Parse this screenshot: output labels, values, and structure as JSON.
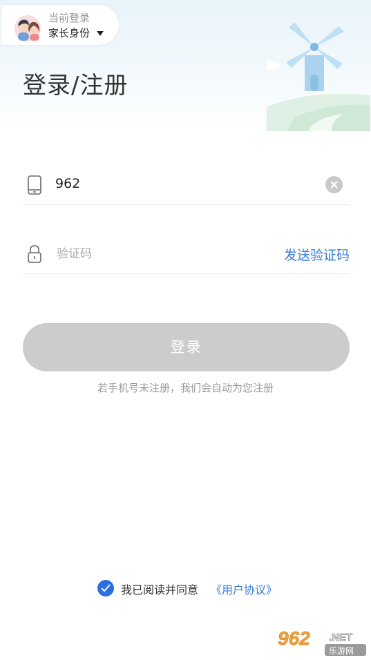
{
  "header": {
    "identity_caption": "当前登录",
    "identity_value": "家长身份",
    "title": "登录/注册"
  },
  "form": {
    "phone_value": "962",
    "code_placeholder": "验证码",
    "send_code_label": "发送验证码"
  },
  "actions": {
    "login_label": "登录",
    "hint": "若手机号未注册，我们会自动为您注册"
  },
  "agreement": {
    "checked": true,
    "text": "我已阅读并同意",
    "link": "《用户协议》"
  },
  "watermark": {
    "brand": "962",
    "domain": ".NET",
    "subtitle": "乐游网"
  },
  "colors": {
    "accent": "#3a7bd5",
    "check": "#2d6ee0",
    "button_disabled": "#cccccc"
  }
}
